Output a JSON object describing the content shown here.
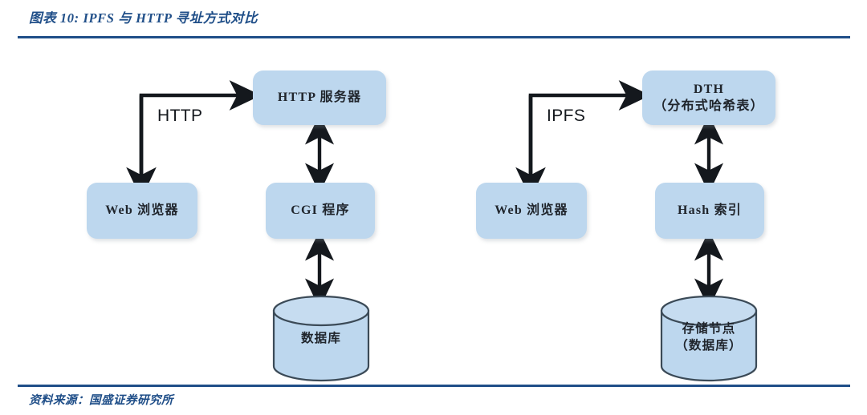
{
  "figure": {
    "title": "图表 10: IPFS 与 HTTP 寻址方式对比",
    "source": "资料来源：国盛证券研究所",
    "accent_color": "#1f4e88",
    "node_fill_color": "#bdd7ee",
    "arrow_color": "#14181d",
    "cylinder_stroke_color": "#3b4a57"
  },
  "left_flow": {
    "protocol_label": "HTTP",
    "nodes": {
      "server": {
        "line1": "HTTP 服务器"
      },
      "browser": {
        "line1": "Web 浏览器"
      },
      "middleware": {
        "line1": "CGI 程序"
      },
      "storage": {
        "line1": "数据库"
      }
    }
  },
  "right_flow": {
    "protocol_label": "IPFS",
    "nodes": {
      "server": {
        "line1": "DTH",
        "line2": "（分布式哈希表）"
      },
      "browser": {
        "line1": "Web 浏览器"
      },
      "middleware": {
        "line1": "Hash 索引"
      },
      "storage": {
        "line1": "存储节点",
        "line2": "（数据库）"
      }
    }
  }
}
